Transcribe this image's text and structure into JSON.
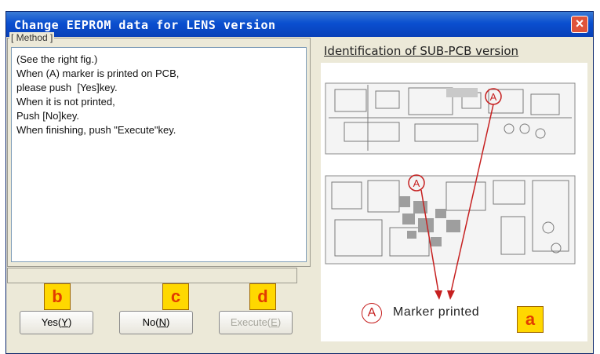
{
  "window": {
    "title": "Change EEPROM data for LENS version",
    "close_label": "×"
  },
  "method": {
    "group_label": "[ Method ]",
    "lines": [
      "(See the right fig.)",
      "",
      "When (A) marker is printed on PCB,",
      "please push  [Yes]key.",
      "When it is not printed,",
      "Push [No]key.",
      "When finishing, push \"Execute\"key."
    ]
  },
  "buttons": {
    "yes": {
      "label": "Yes(",
      "accel": "Y",
      "end": ")"
    },
    "no": {
      "label": "No(",
      "accel": "N",
      "end": ")"
    },
    "execute": {
      "label": "Execute(",
      "accel": "E",
      "end": ")"
    }
  },
  "right": {
    "title": "Identification of SUB-PCB version",
    "marker_symbol": "A",
    "caption": "Marker  printed"
  },
  "callouts": {
    "a": "a",
    "b": "b",
    "c": "c",
    "d": "d"
  },
  "colors": {
    "callout_bg": "#ffd800",
    "callout_text": "#e23c00",
    "marker_red": "#c62020"
  }
}
